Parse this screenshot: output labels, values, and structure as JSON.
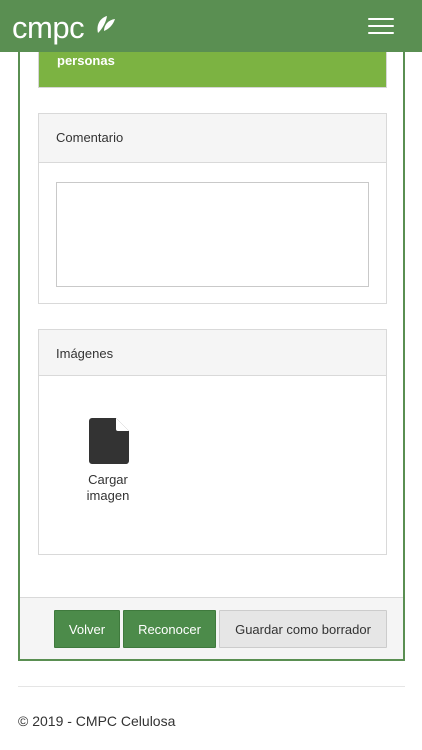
{
  "header": {
    "logo_text": "cmpc",
    "brand_color": "#5a8f52",
    "menu_icon": "hamburger-menu-icon"
  },
  "alert": {
    "text": "personas",
    "color": "#7cb342"
  },
  "comment_panel": {
    "title": "Comentario",
    "textarea_value": ""
  },
  "images_panel": {
    "title": "Imágenes",
    "upload_icon": "file-icon",
    "upload_label": "Cargar imagen"
  },
  "actions": {
    "back_label": "Volver",
    "acknowledge_label": "Reconocer",
    "save_draft_label": "Guardar como borrador"
  },
  "footer": {
    "copyright": "© 2019 - CMPC Celulosa"
  }
}
